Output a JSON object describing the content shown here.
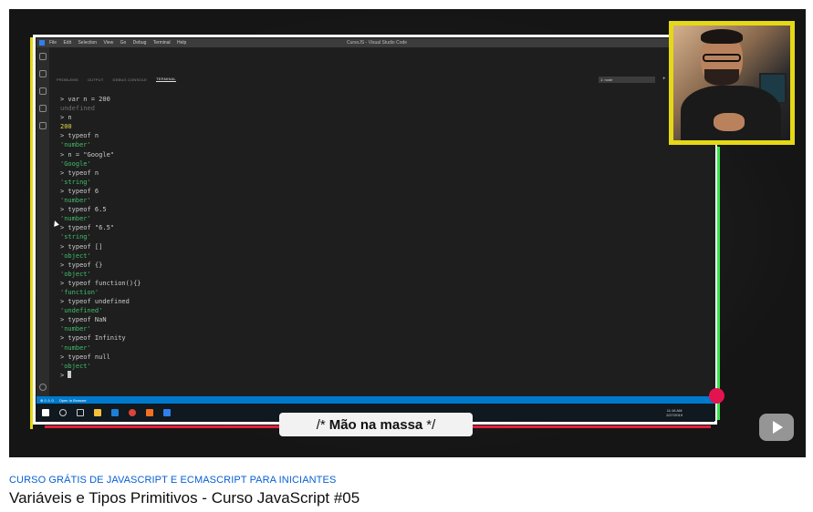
{
  "video": {
    "caption_prefix": "/*",
    "caption_text": "Mão na massa",
    "caption_suffix": "*/"
  },
  "vscode": {
    "menu": [
      "File",
      "Edit",
      "Selection",
      "View",
      "Go",
      "Debug",
      "Terminal",
      "Help"
    ],
    "window_title": "CursoJS - Visual Studio Code",
    "panel_tabs": [
      "PROBLEMS",
      "OUTPUT",
      "DEBUG CONSOLE",
      "TERMINAL"
    ],
    "terminal_select": "1: node",
    "terminal_plus": "+",
    "terminal_lines": [
      {
        "kind": "in",
        "text": "> var n = 200"
      },
      {
        "kind": "undef",
        "text": "undefined"
      },
      {
        "kind": "in",
        "text": "> n"
      },
      {
        "kind": "num",
        "text": "200"
      },
      {
        "kind": "in",
        "text": "> typeof n"
      },
      {
        "kind": "str",
        "text": "'number'"
      },
      {
        "kind": "in",
        "text": "> n = \"Google\""
      },
      {
        "kind": "str",
        "text": "'Google'"
      },
      {
        "kind": "in",
        "text": "> typeof n"
      },
      {
        "kind": "str",
        "text": "'string'"
      },
      {
        "kind": "in",
        "text": "> typeof 6"
      },
      {
        "kind": "str",
        "text": "'number'"
      },
      {
        "kind": "in",
        "text": "> typeof 6.5"
      },
      {
        "kind": "str",
        "text": "'number'"
      },
      {
        "kind": "in",
        "text": "> typeof \"6.5\""
      },
      {
        "kind": "str",
        "text": "'string'"
      },
      {
        "kind": "in",
        "text": "> typeof []"
      },
      {
        "kind": "str",
        "text": "'object'"
      },
      {
        "kind": "in",
        "text": "> typeof {}"
      },
      {
        "kind": "str",
        "text": "'object'"
      },
      {
        "kind": "in",
        "text": "> typeof function(){}"
      },
      {
        "kind": "str",
        "text": "'function'"
      },
      {
        "kind": "in",
        "text": "> typeof undefined"
      },
      {
        "kind": "str",
        "text": "'undefined'"
      },
      {
        "kind": "in",
        "text": "> typeof NaN"
      },
      {
        "kind": "str",
        "text": "'number'"
      },
      {
        "kind": "in",
        "text": "> typeof Infinity"
      },
      {
        "kind": "str",
        "text": "'number'"
      },
      {
        "kind": "in",
        "text": "> typeof null"
      },
      {
        "kind": "str",
        "text": "'object'"
      }
    ],
    "prompt": ">",
    "statusbar": [
      "⊗ 0 ⚠ 0",
      "Open In Browser"
    ],
    "clock_time": "11:16 AM",
    "clock_date": "2/27/2019"
  },
  "meta": {
    "playlist": "CURSO GRÁTIS DE JAVASCRIPT E ECMASCRIPT PARA INICIANTES",
    "title": "Variáveis e Tipos Primitivos - Curso JavaScript #05"
  },
  "colors": {
    "webcam_border": "#e5d816",
    "vscode_statusbar": "#007acc",
    "link_blue": "#065fd4",
    "record_dot": "#e4134f"
  },
  "icons": [
    "explorer-icon",
    "search-icon",
    "source-control-icon",
    "debug-icon",
    "extensions-icon",
    "gear-icon",
    "play-logo-icon"
  ]
}
